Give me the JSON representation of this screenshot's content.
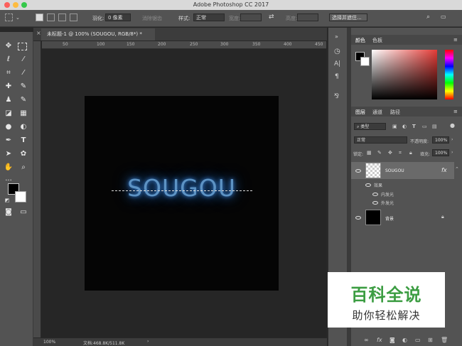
{
  "window": {
    "title": "Adobe Photoshop CC 2017"
  },
  "options_bar": {
    "feather_label": "羽化:",
    "feather_value": "0 像素",
    "antialias_label": "消除锯齿",
    "style_label": "样式:",
    "style_value": "正常",
    "width_label": "宽度:",
    "height_label": "高度:",
    "select_mask_button": "选择并遮住..."
  },
  "document": {
    "tab_title": "未标题-1 @ 100% (SOUGOU, RGB/8*) *",
    "canvas_text": "SOUGOU",
    "ruler_ticks": [
      "50",
      "100",
      "150",
      "200",
      "250",
      "300",
      "350",
      "400",
      "450"
    ],
    "zoom": "100%",
    "doc_size": "文档:468.8K/511.8K"
  },
  "panels": {
    "color_tabs": [
      "颜色",
      "色板"
    ],
    "layer_tabs": [
      "图层",
      "通道",
      "路径"
    ],
    "filter_kind": "类型",
    "blend_mode": "正常",
    "opacity_label": "不透明度:",
    "opacity_value": "100%",
    "lock_label": "锁定:",
    "fill_label": "填充:",
    "fill_value": "100%",
    "layers": [
      {
        "name": "SOUGOU",
        "fx": "fx"
      },
      {
        "name": "背景"
      }
    ],
    "effects_label": "效果",
    "effects": [
      "内发光",
      "外发光"
    ]
  },
  "watermark": {
    "title": "百科全说",
    "subtitle": "助你轻松解决"
  },
  "colors": {
    "ui_bg": "#535353",
    "canvas_bg": "#050505",
    "glow_text": "#5d93c4",
    "watermark_green": "#3c9d42"
  }
}
